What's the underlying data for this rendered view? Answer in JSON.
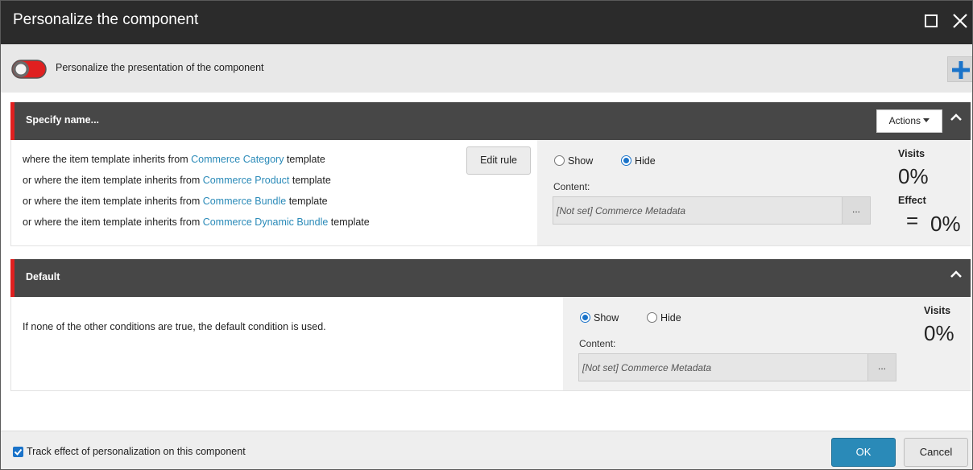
{
  "window": {
    "title": "Personalize the component"
  },
  "toolbar": {
    "toggle_label": "Personalize the presentation of the component",
    "toggle_on": true
  },
  "rules": [
    {
      "name": "Specify name...",
      "actions_label": "Actions",
      "conditions": [
        {
          "prefix": "where the item template inherits from ",
          "link": "Commerce Category",
          "suffix": " template"
        },
        {
          "prefix": "or where the item template inherits from ",
          "link": "Commerce Product",
          "suffix": " template"
        },
        {
          "prefix": "or where the item template inherits from ",
          "link": "Commerce Bundle",
          "suffix": " template"
        },
        {
          "prefix": "or where the item template inherits from ",
          "link": "Commerce Dynamic Bundle",
          "suffix": " template"
        }
      ],
      "edit_rule_label": "Edit rule",
      "show_label": "Show",
      "hide_label": "Hide",
      "selected": "Hide",
      "content_label": "Content:",
      "content_value": "[Not set] Commerce Metadata",
      "browse_label": "...",
      "visits_label": "Visits",
      "visits_value": "0%",
      "effect_label": "Effect",
      "effect_symbol": "=",
      "effect_value": "0%"
    },
    {
      "name": "Default",
      "description": "If none of the other conditions are true, the default condition is used.",
      "show_label": "Show",
      "hide_label": "Hide",
      "selected": "Show",
      "content_label": "Content:",
      "content_value": "[Not set] Commerce Metadata",
      "browse_label": "...",
      "visits_label": "Visits",
      "visits_value": "0%"
    }
  ],
  "footer": {
    "track_label": "Track effect of personalization on this component",
    "track_checked": true,
    "ok_label": "OK",
    "cancel_label": "Cancel"
  },
  "colors": {
    "accent_red": "#e02020",
    "primary_blue": "#2a8ab8",
    "radio_blue": "#1a73c9",
    "header_dark": "#474747",
    "title_bar": "#2b2b2b"
  },
  "icons": {
    "maximize": "maximize-icon",
    "close": "close-icon",
    "toggle": "toggle-switch-icon",
    "add": "plus-icon",
    "collapse": "chevron-up-icon",
    "actions_caret": "caret-down-icon",
    "checkbox": "checkbox-checked-icon"
  }
}
